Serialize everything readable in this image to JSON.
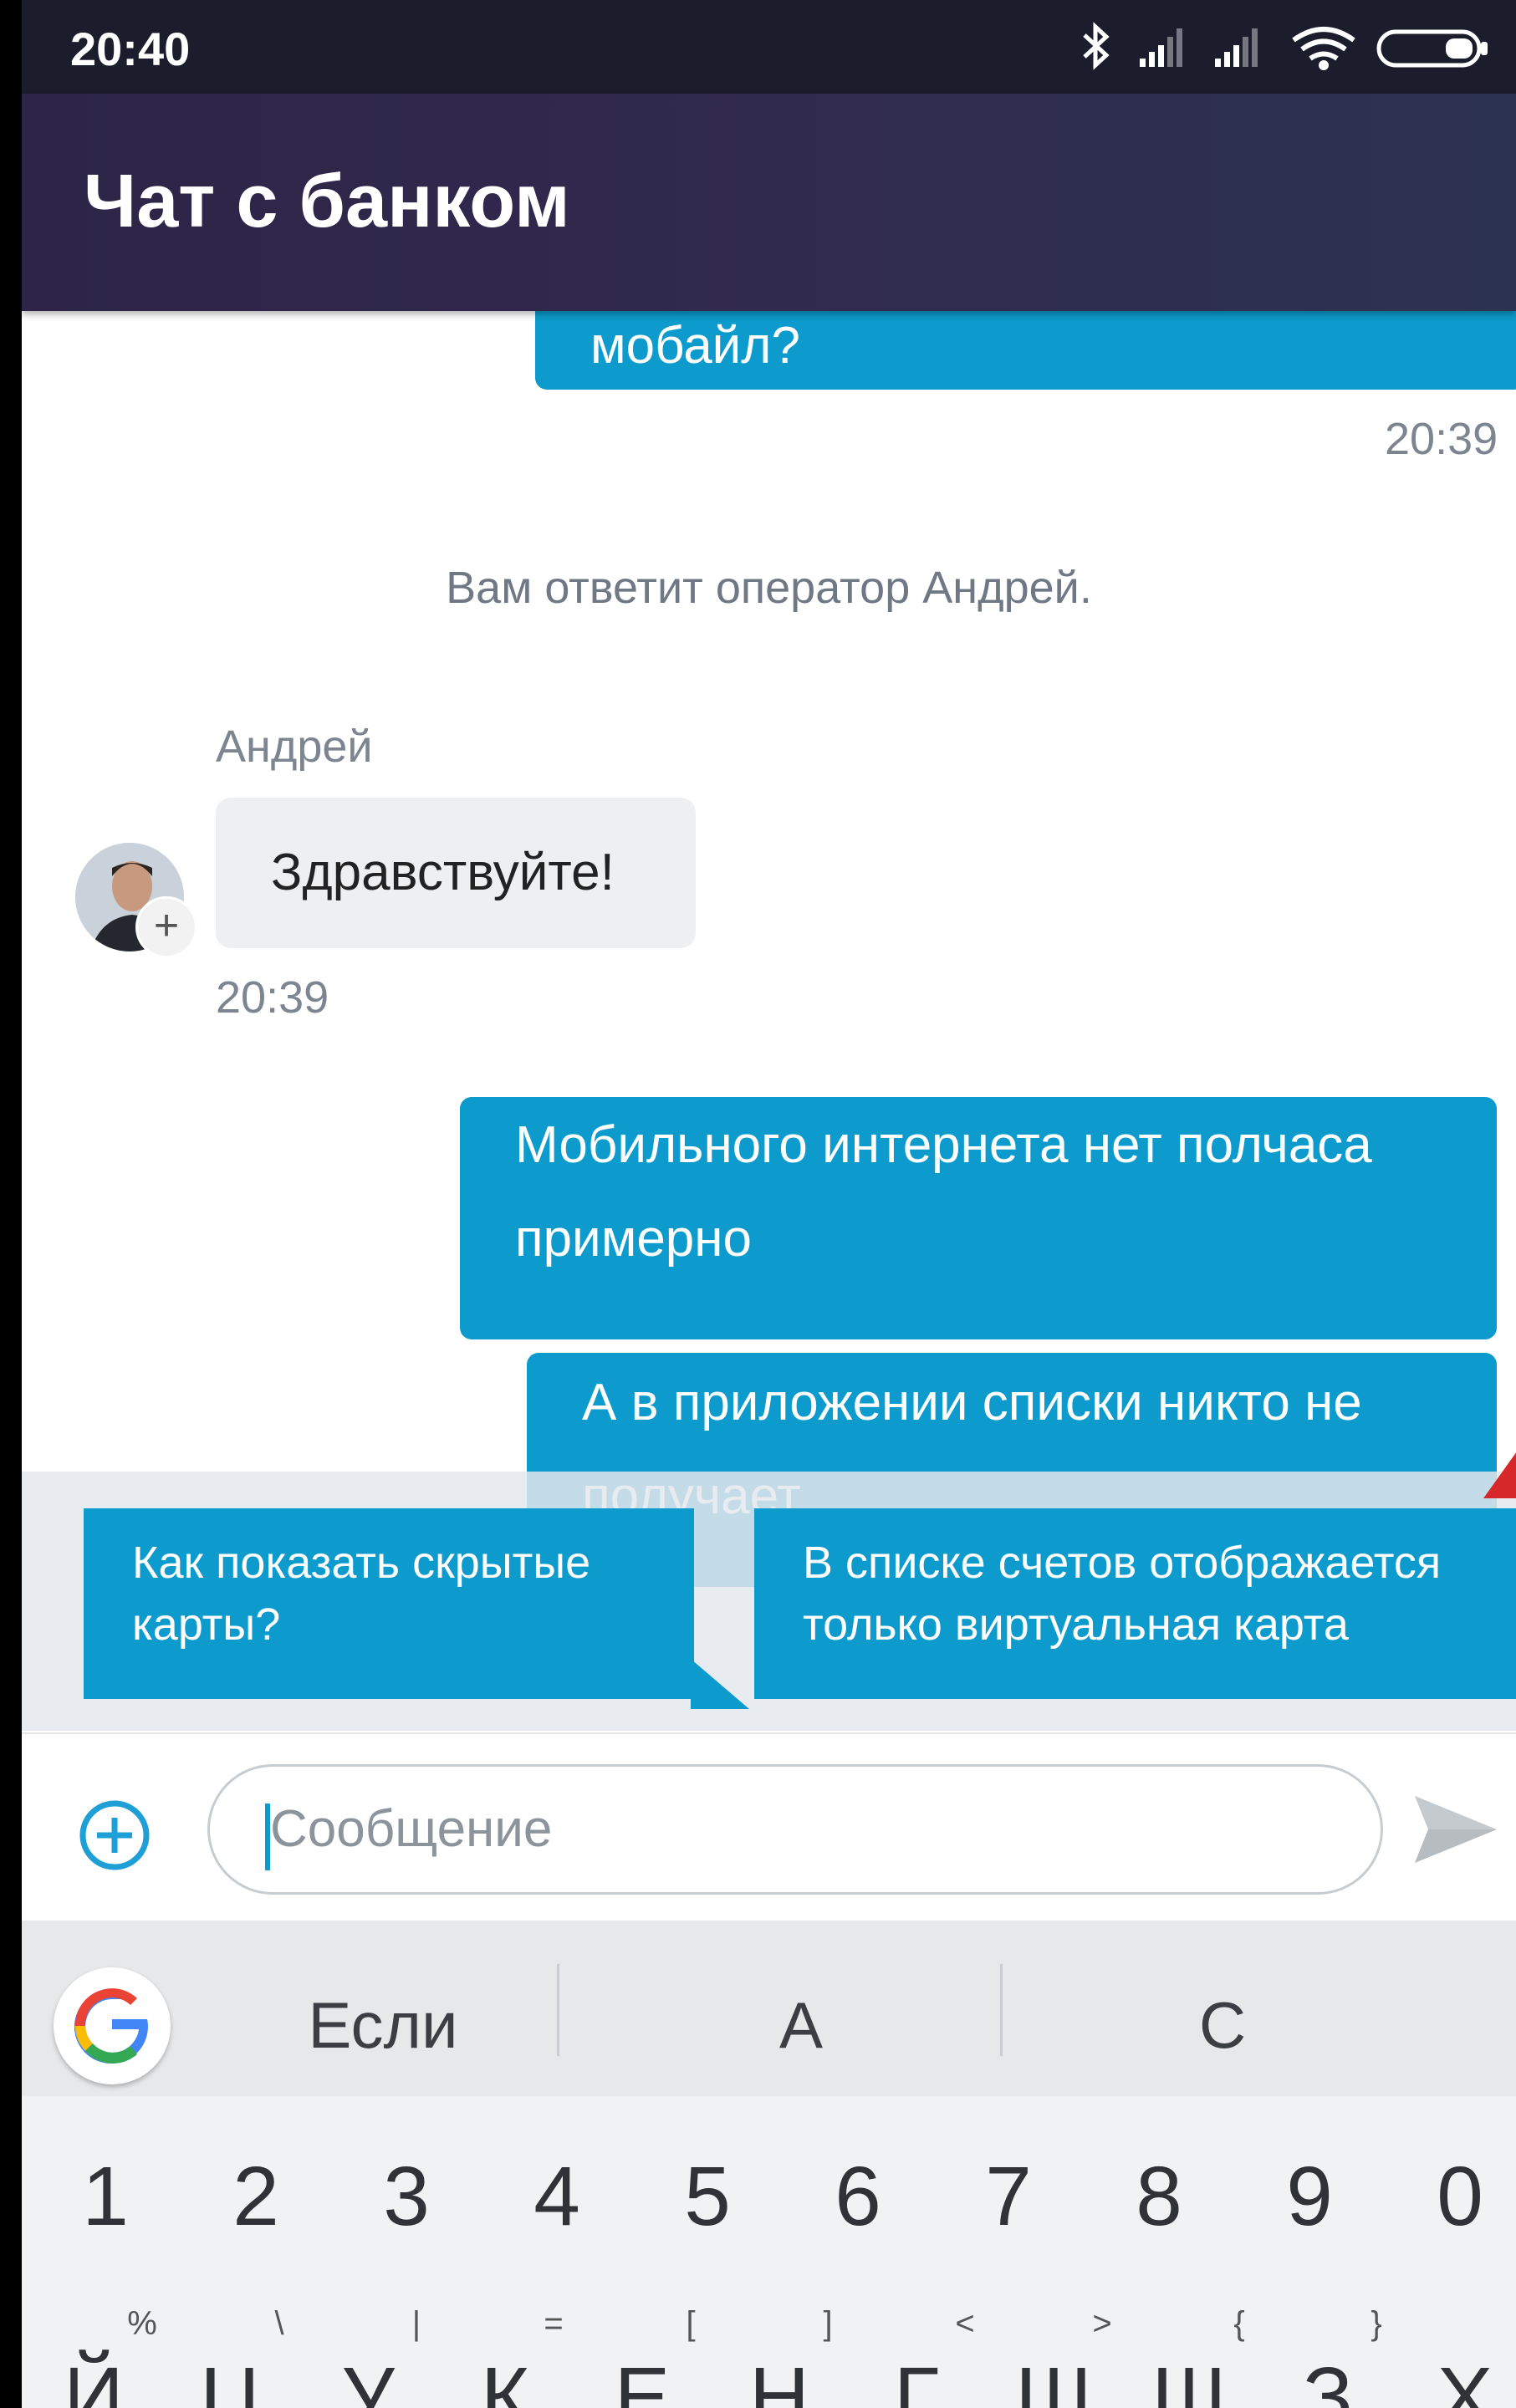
{
  "status_bar": {
    "time": "20:40",
    "icons": [
      "bluetooth-icon",
      "signal-icon",
      "signal-icon",
      "wifi-icon",
      "battery-icon"
    ]
  },
  "app_bar": {
    "title": "Чат с банком"
  },
  "chat": {
    "messages": [
      {
        "from": "user",
        "text": "мобайл?",
        "time": "20:39"
      },
      {
        "from": "system",
        "text": "Вам ответит оператор Андрей."
      },
      {
        "from": "operator",
        "name": "Андрей",
        "text": "Здравствуйте!",
        "time": "20:39"
      },
      {
        "from": "user",
        "text_lines": [
          "Мобильного интернета нет полчаса",
          "примерно"
        ]
      },
      {
        "from": "user",
        "text_lines": [
          "А в приложении списки никто не",
          "получает"
        ]
      }
    ]
  },
  "quick_replies": [
    {
      "lines": [
        "Как показать скрытые",
        "карты?"
      ]
    },
    {
      "lines": [
        "В списке счетов отображается",
        "только виртуальная карта"
      ]
    }
  ],
  "input": {
    "placeholder": "Сообщение",
    "value": ""
  },
  "keyboard": {
    "suggestions": [
      "Если",
      "А",
      "С"
    ],
    "number_row": [
      "1",
      "2",
      "3",
      "4",
      "5",
      "6",
      "7",
      "8",
      "9",
      "0"
    ],
    "hint_row": [
      "%",
      "\\",
      "|",
      "=",
      "[",
      "]",
      "<",
      ">",
      "{",
      "}"
    ],
    "letter_row": [
      "Й",
      "Ц",
      "У",
      "К",
      "Е",
      "Н",
      "Г",
      "Ш",
      "Щ",
      "З",
      "Х"
    ]
  },
  "colors": {
    "bubble_out": "#0c9bcc",
    "app_bar": "#2c2547",
    "accent_marker": "#d6272a"
  }
}
